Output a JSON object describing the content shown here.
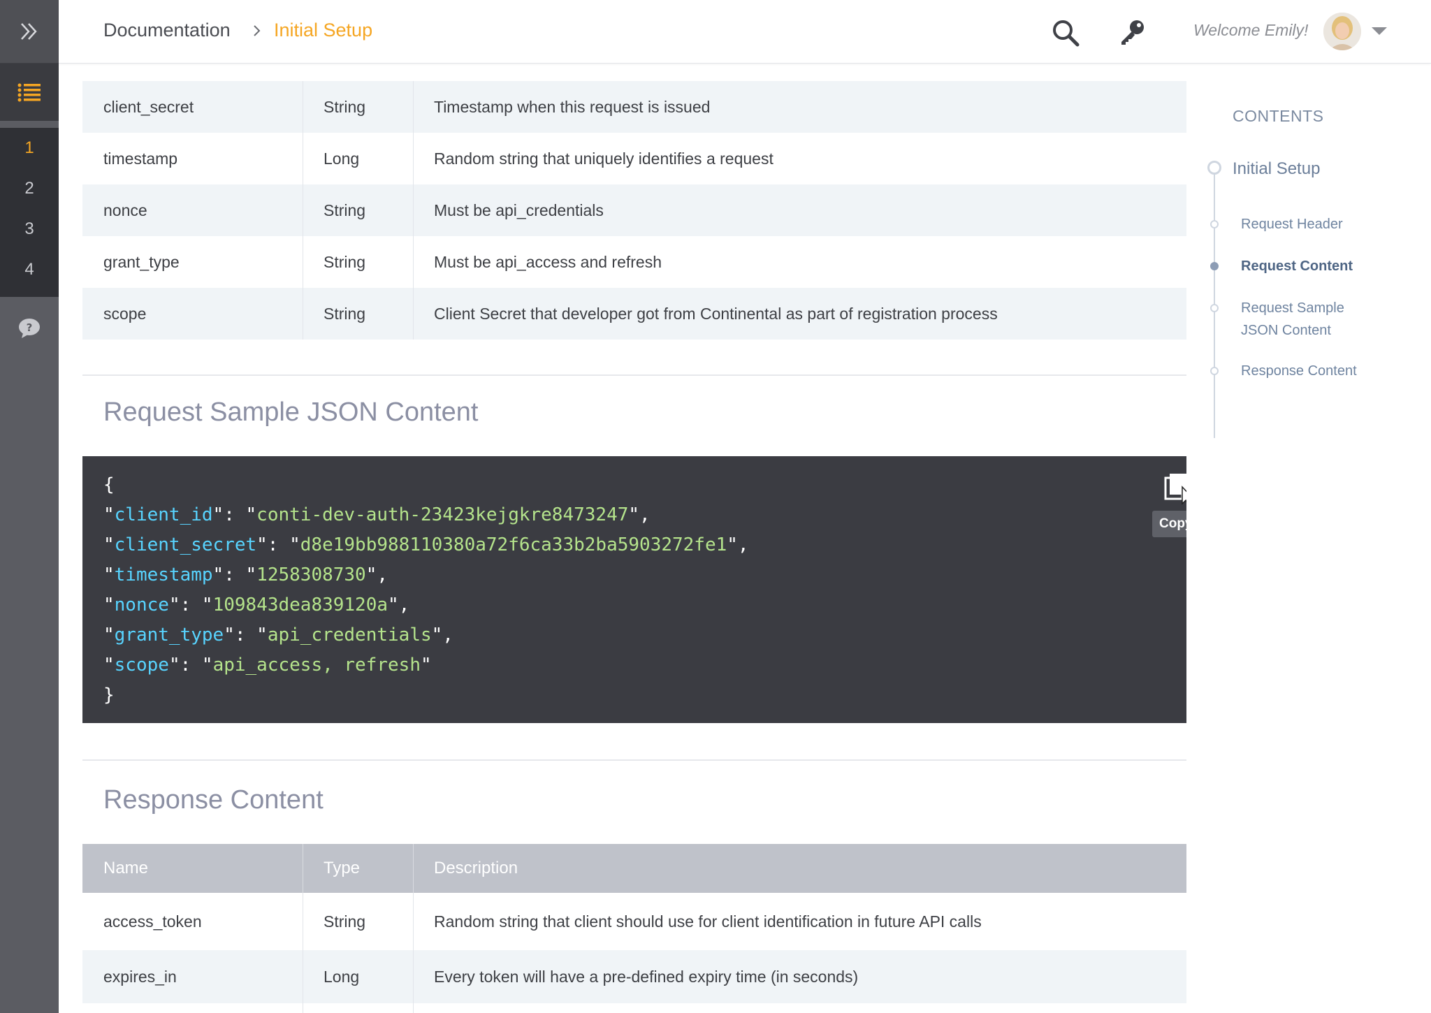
{
  "topbar": {
    "breadcrumb_root": "Documentation",
    "breadcrumb_current": "Initial Setup",
    "welcome": "Welcome Emily!"
  },
  "rail": {
    "steps": [
      "1",
      "2",
      "3",
      "4"
    ],
    "active_step": "1"
  },
  "request_table": {
    "rows": [
      {
        "name": "client_secret",
        "type": "String",
        "description": "Timestamp when this request is issued"
      },
      {
        "name": "timestamp",
        "type": "Long",
        "description": "Random string that uniquely identifies a request"
      },
      {
        "name": "nonce",
        "type": "String",
        "description": "Must be api_credentials"
      },
      {
        "name": "grant_type",
        "type": "String",
        "description": "Must be api_access and refresh"
      },
      {
        "name": "scope",
        "type": "String",
        "description": "Client Secret that developer got from Continental as part of registration process"
      }
    ]
  },
  "sample_section": {
    "title": "Request Sample JSON Content",
    "code_open": "{",
    "code_close": "}",
    "code_lines": [
      {
        "key": "client_id",
        "value": "conti-dev-auth-23423kejgkre8473247",
        "comma": ","
      },
      {
        "key": "client_secret",
        "value": "d8e19bb988110380a72f6ca33b2ba5903272fe1",
        "comma": ","
      },
      {
        "key": "timestamp",
        "value": "1258308730",
        "comma": ","
      },
      {
        "key": "nonce",
        "value": "109843dea839120a",
        "comma": ","
      },
      {
        "key": "grant_type",
        "value": "api_credentials",
        "comma": ","
      },
      {
        "key": "scope",
        "value": "api_access, refresh",
        "comma": ""
      }
    ],
    "copy_label": "Copy"
  },
  "response_section": {
    "title": "Response Content",
    "headers": {
      "name": "Name",
      "type": "Type",
      "description": "Description"
    },
    "rows": [
      {
        "name": "access_token",
        "type": "String",
        "description": "Random string that client should use for client identification in future API calls"
      },
      {
        "name": "expires_in",
        "type": "Long",
        "description": "Every token will have a pre-defined expiry time (in seconds)"
      }
    ]
  },
  "contents": {
    "heading": "CONTENTS",
    "root": "Initial Setup",
    "items": [
      {
        "label": "Request Header",
        "active": false
      },
      {
        "label": "Request Content",
        "active": true
      },
      {
        "label": "Request Sample JSON Content",
        "active": false
      },
      {
        "label": "Response Content",
        "active": false
      }
    ]
  },
  "colors": {
    "accent": "#f5a623",
    "code_bg": "#3b3c42",
    "code_key": "#58d4ff",
    "code_value": "#b5e48c",
    "table_header": "#bfc2ca"
  }
}
